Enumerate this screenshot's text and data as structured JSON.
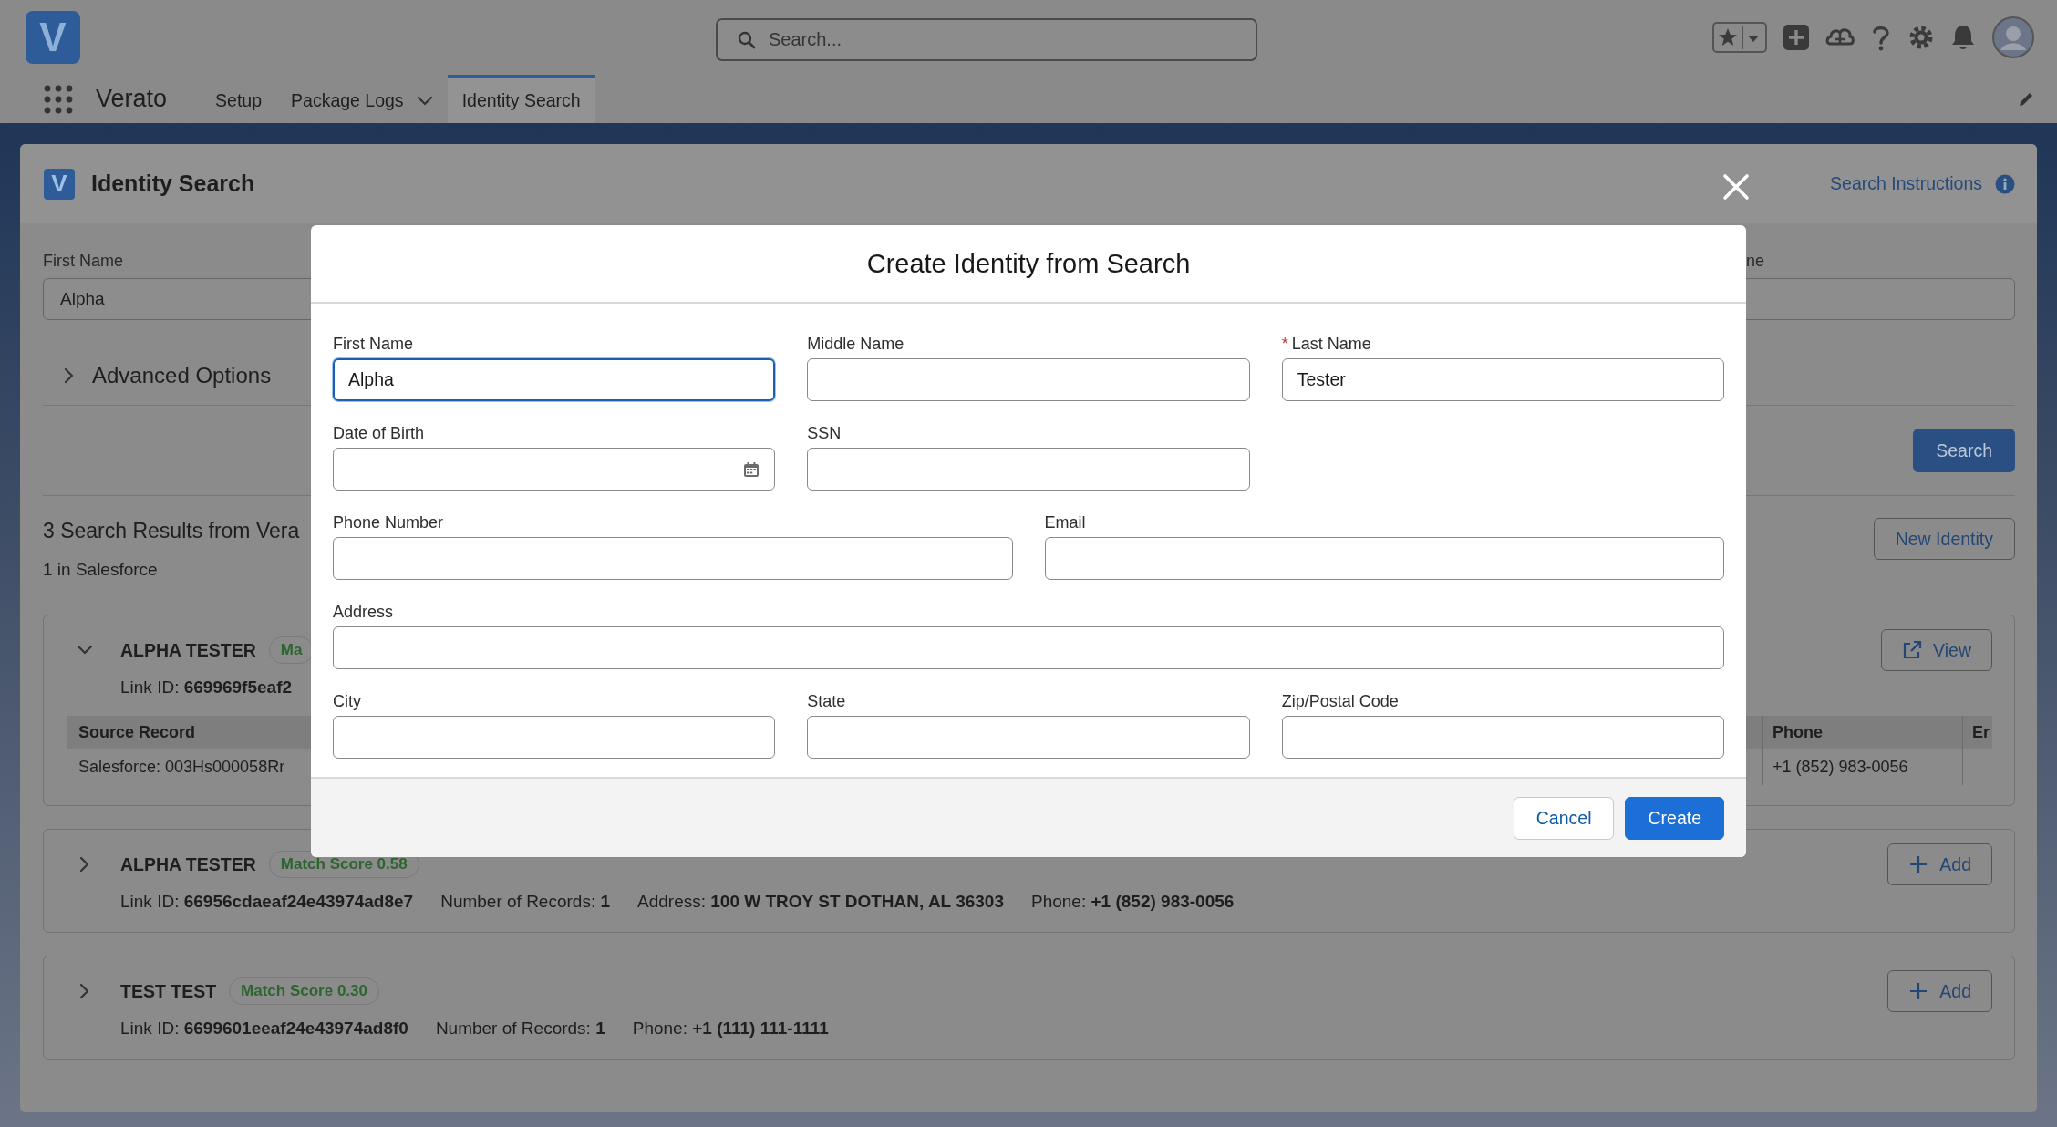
{
  "app_bar": {
    "logo": "V",
    "search": {
      "placeholder": "Search..."
    }
  },
  "nav": {
    "app_name": "Verato",
    "items": [
      {
        "label": "Setup",
        "selected": false,
        "menu": false
      },
      {
        "label": "Package Logs",
        "selected": false,
        "menu": true
      },
      {
        "label": "Identity Search",
        "selected": true,
        "menu": false
      }
    ]
  },
  "page": {
    "logo": "V",
    "title": "Identity Search",
    "help_link": "Search Instructions",
    "filters": [
      {
        "label": "First Name",
        "value": "Alpha"
      },
      {
        "label": "ne"
      }
    ],
    "advanced_options": {
      "label": "Advanced Options",
      "expanded": false
    },
    "search_button": "Search",
    "results": {
      "heading": "3 Search Results from Vera",
      "subheading": "1 in Salesforce",
      "new_button": "New Identity",
      "items": [
        {
          "name": "ALPHA TESTER",
          "badge": "Ma",
          "expanded": true,
          "action": {
            "kind": "view",
            "label": "View"
          },
          "details": [
            "Link ID: **669969f5eaf2**"
          ],
          "table": {
            "columns": [
              "Source Record",
              "Phone",
              "Er"
            ],
            "rows": [
              [
                "Salesforce: 003Hs000058Rr",
                "+1 (852) 983-0056"
              ]
            ]
          }
        },
        {
          "name": "ALPHA TESTER",
          "badge": "Match Score 0.58",
          "expanded": false,
          "action": {
            "kind": "add",
            "label": "Add"
          },
          "details": [
            "Link ID: **66956cdaeaf24e43974ad8e7**",
            "Number of Records: **1**",
            "Address: **100 W TROY ST DOTHAN, AL 36303**",
            "Phone: **+1 (852) 983-0056**"
          ]
        },
        {
          "name": "TEST TEST",
          "badge": "Match Score 0.30",
          "expanded": false,
          "action": {
            "kind": "add",
            "label": "Add"
          },
          "details": [
            "Link ID: **6699601eeaf24e43974ad8f0**",
            "Number of Records: **1**",
            "Phone: **+1 (111) 111-1111**"
          ]
        }
      ]
    }
  },
  "modal": {
    "title": "Create Identity from Search",
    "required_mark": "*",
    "rows": [
      {
        "kind": "thirds",
        "fields": [
          {
            "label": "First Name",
            "kind": "text",
            "value": "Alpha",
            "required": false,
            "focused": true
          },
          {
            "label": "Middle Name",
            "kind": "text",
            "required": false,
            "focused": false
          },
          {
            "label": "Last Name",
            "kind": "text",
            "value": "Tester",
            "required": true,
            "focused": false
          }
        ]
      },
      {
        "kind": "thirds",
        "fields": [
          {
            "label": "Date of Birth",
            "kind": "date",
            "required": false,
            "focused": false
          },
          {
            "label": "SSN",
            "kind": "text",
            "required": false,
            "focused": false
          }
        ]
      },
      {
        "kind": "halves",
        "fields": [
          {
            "label": "Phone Number",
            "kind": "text",
            "required": false,
            "focused": false
          },
          {
            "label": "Email",
            "kind": "text",
            "required": false,
            "focused": false
          }
        ]
      },
      {
        "kind": "full",
        "fields": [
          {
            "label": "Address",
            "kind": "text",
            "required": false,
            "focused": false
          }
        ]
      },
      {
        "kind": "thirds",
        "fields": [
          {
            "label": "City",
            "kind": "text",
            "required": false,
            "focused": false
          },
          {
            "label": "State",
            "kind": "text",
            "required": false,
            "focused": false
          },
          {
            "label": "Zip/Postal Code",
            "kind": "text",
            "required": false,
            "focused": false
          }
        ]
      }
    ],
    "buttons": [
      {
        "label": "Cancel",
        "kind": "neutral"
      },
      {
        "label": "Create",
        "kind": "brand"
      }
    ]
  }
}
